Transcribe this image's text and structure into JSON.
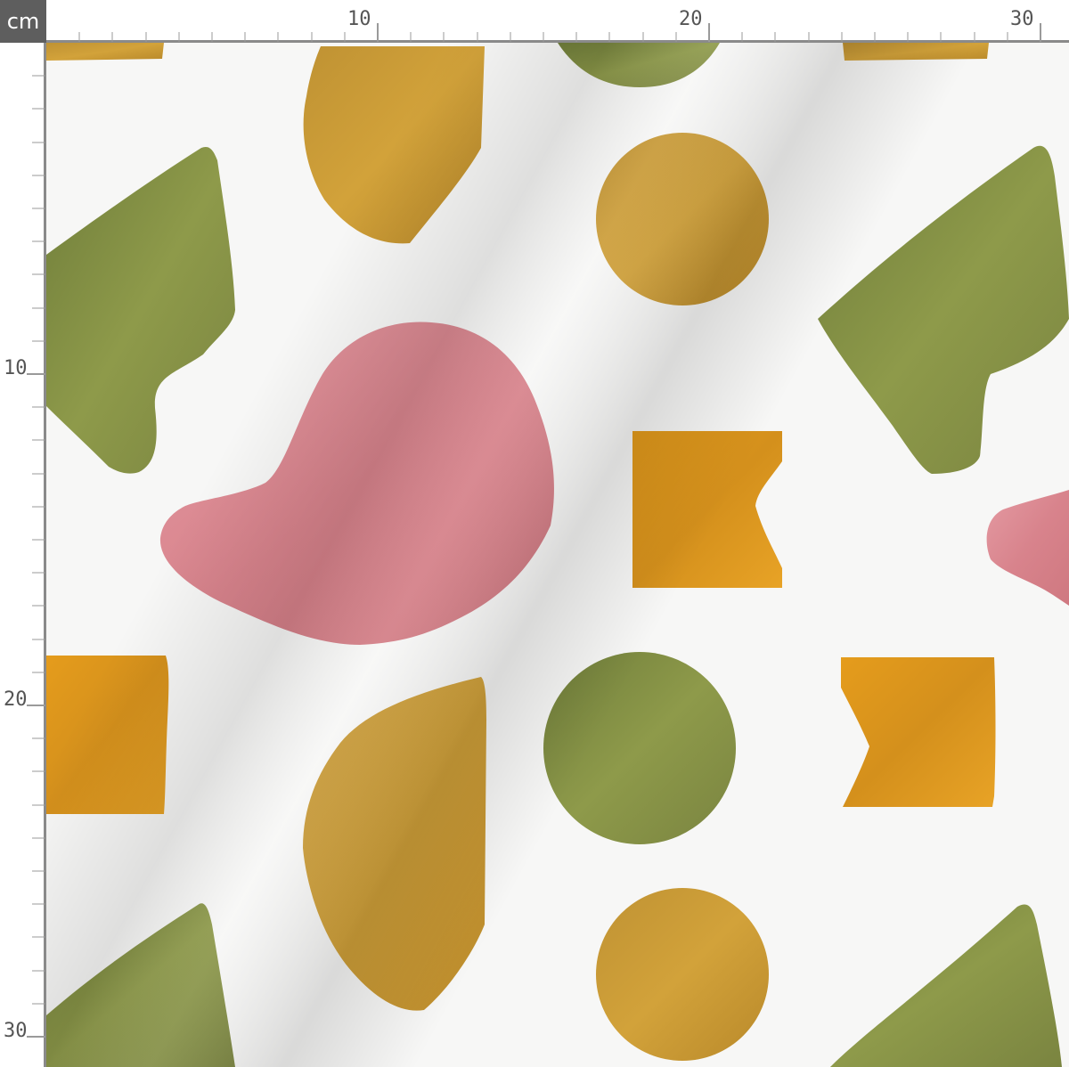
{
  "ruler": {
    "unit": "cm",
    "top_labels": [
      "10",
      "20",
      "30"
    ],
    "left_labels": [
      "10",
      "20",
      "30"
    ]
  },
  "palette": {
    "olive": "#8a9446",
    "mustard": "#c99a2e",
    "orange": "#e09a1e",
    "pink": "#d98890",
    "background": "#f7f7f6"
  }
}
